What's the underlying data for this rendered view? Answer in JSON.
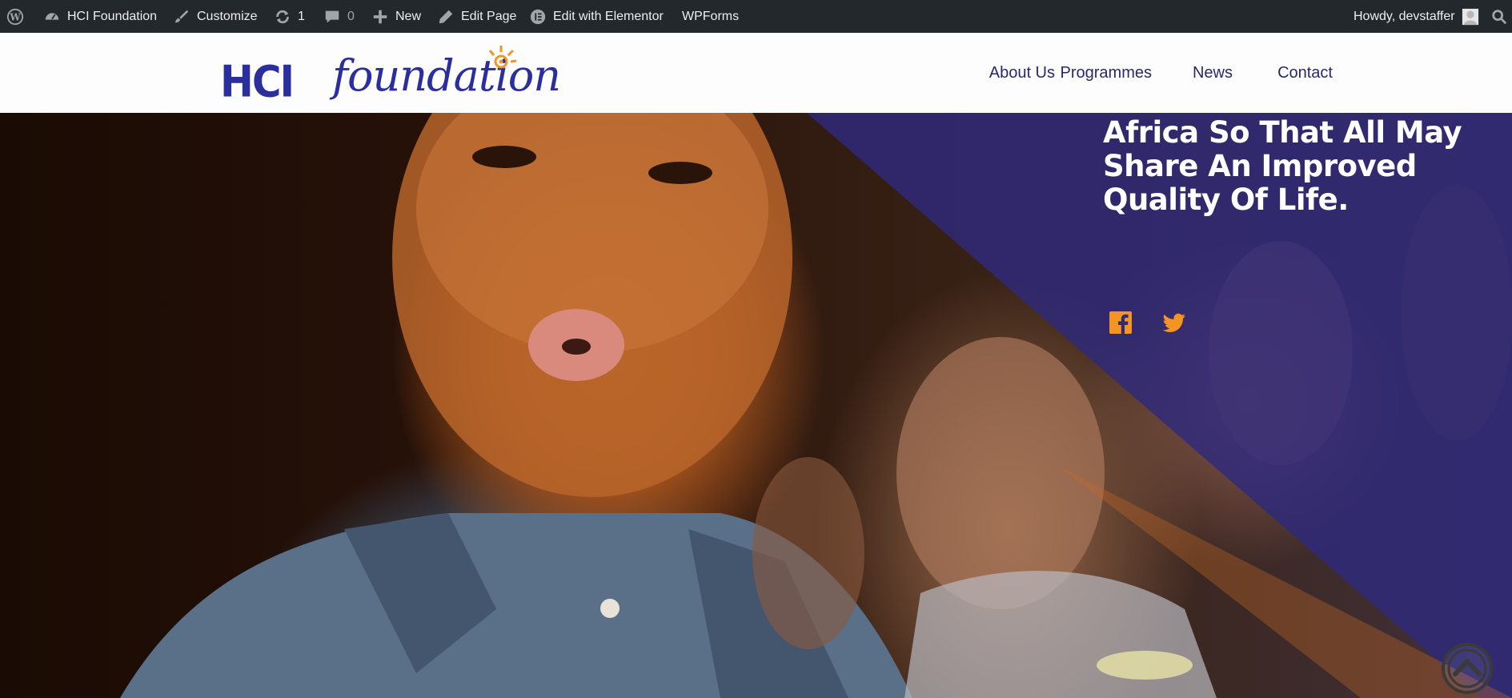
{
  "adminbar": {
    "site_name": "HCI Foundation",
    "customize": "Customize",
    "updates_count": "1",
    "comments_count": "0",
    "new": "New",
    "edit_page": "Edit Page",
    "edit_elementor": "Edit with Elementor",
    "wpforms": "WPForms",
    "greeting": "Howdy, devstaffer"
  },
  "header": {
    "logo_text_1": "HCI",
    "logo_text_2": "foundation",
    "nav": [
      "About Us",
      "Programmes",
      "News",
      "Contact"
    ]
  },
  "hero": {
    "heading_lines": [
      "Africa So That All May",
      "Share An Improved",
      "Quality Of Life."
    ]
  },
  "colors": {
    "adminbar_bg": "#23282d",
    "brand_blue": "#2b2f9e",
    "nav_text": "#27296e",
    "overlay_purple": "#2e2a7c",
    "social_orange": "#f39423"
  },
  "icons": {
    "social": [
      "facebook-icon",
      "twitter-icon"
    ],
    "scroll": "scroll-to-top-icon"
  }
}
